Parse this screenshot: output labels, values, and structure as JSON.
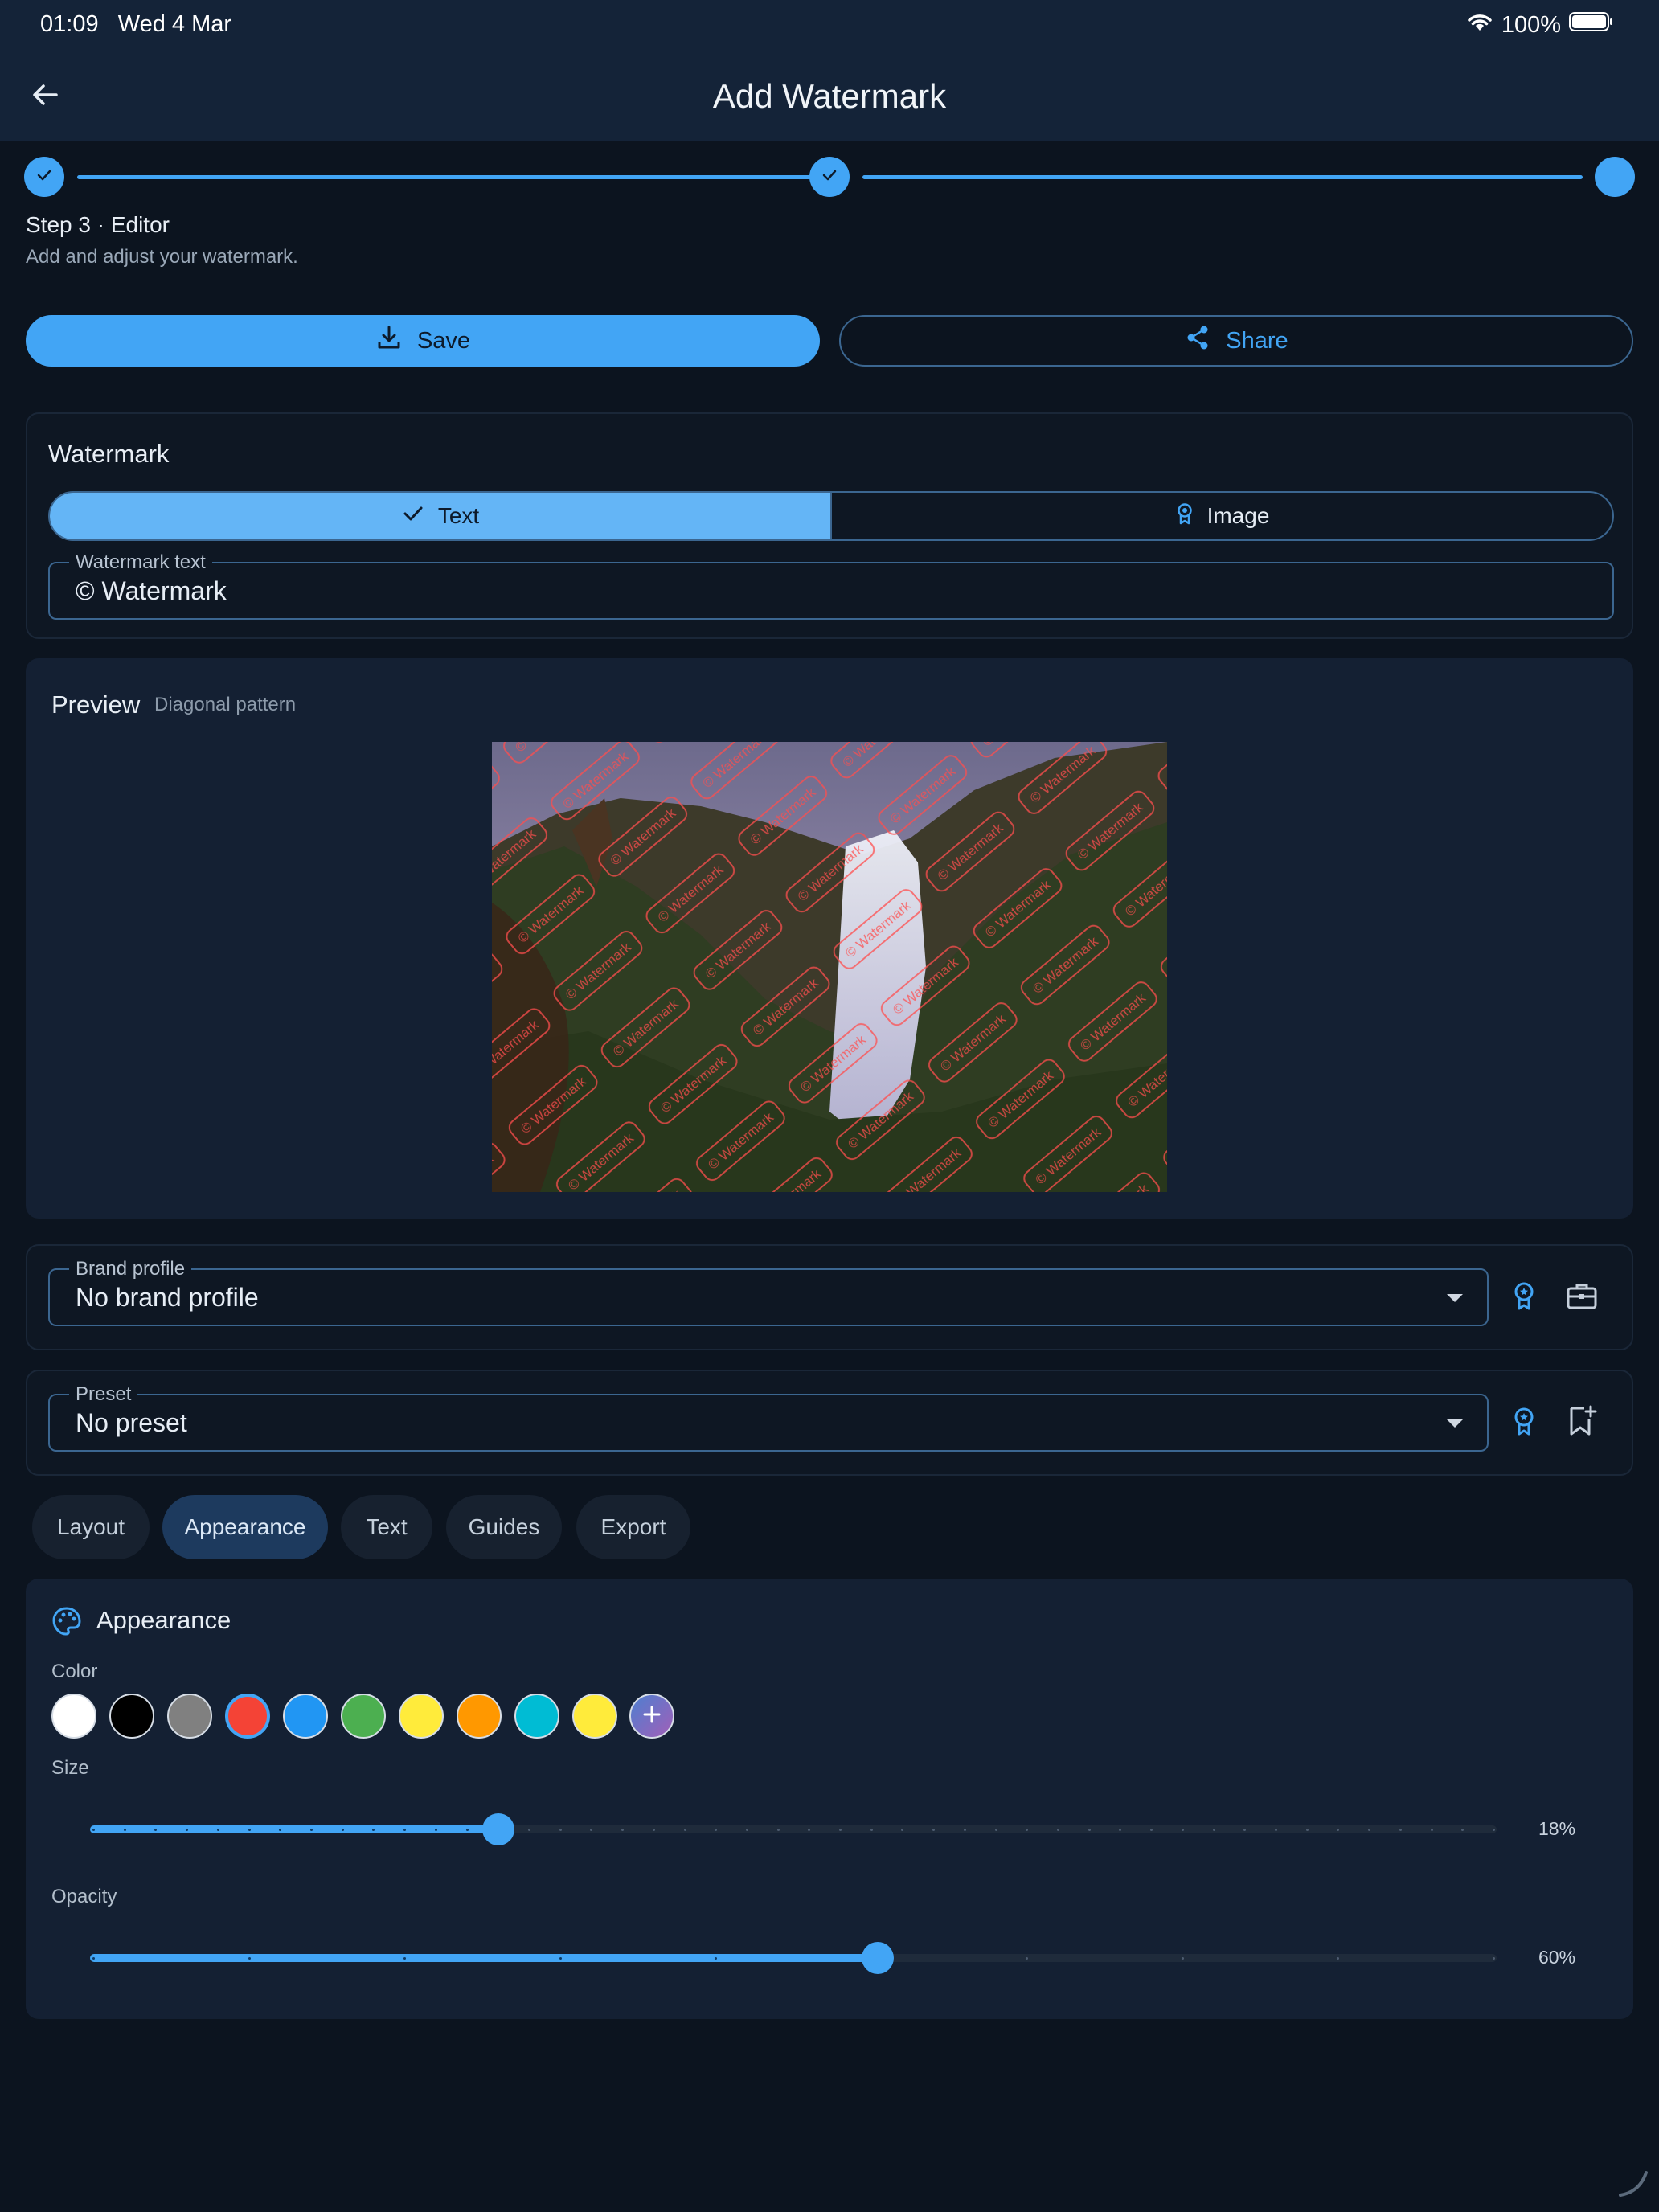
{
  "status": {
    "time": "01:09",
    "date": "Wed 4 Mar",
    "battery": "100%"
  },
  "appbar": {
    "title": "Add Watermark",
    "back_icon": "arrow-left-icon"
  },
  "stepper": {
    "step_title": "Step 3 · Editor",
    "step_subtitle": "Add and adjust your watermark.",
    "steps_completed": 2,
    "total_steps": 3
  },
  "actions": {
    "save_label": "Save",
    "share_label": "Share"
  },
  "watermark": {
    "title": "Watermark",
    "modes": [
      {
        "label": "Text",
        "selected": true
      },
      {
        "label": "Image",
        "selected": false
      }
    ],
    "text_field_label": "Watermark text",
    "text_value": "© Watermark"
  },
  "preview": {
    "title": "Preview",
    "subtitle": "Diagonal pattern",
    "watermark_text": "© Watermark",
    "watermark_color": "#e53935"
  },
  "brand": {
    "label": "Brand profile",
    "value": "No brand profile"
  },
  "preset": {
    "label": "Preset",
    "value": "No preset"
  },
  "tabs": [
    {
      "label": "Layout",
      "selected": false
    },
    {
      "label": "Appearance",
      "selected": true
    },
    {
      "label": "Text",
      "selected": false
    },
    {
      "label": "Guides",
      "selected": false
    },
    {
      "label": "Export",
      "selected": false
    }
  ],
  "appearance": {
    "title": "Appearance",
    "color_label": "Color",
    "colors": [
      "#ffffff",
      "#000000",
      "#808080",
      "#f44336",
      "#2196f3",
      "#4caf50",
      "#ffeb3b",
      "#ff9800",
      "#00bcd4",
      "#ffeb3b"
    ],
    "selected_color": "#f44336",
    "size_label": "Size",
    "size_value": "18%",
    "size_fraction": 0.29,
    "opacity_label": "Opacity",
    "opacity_value": "60%",
    "opacity_fraction": 0.56
  }
}
